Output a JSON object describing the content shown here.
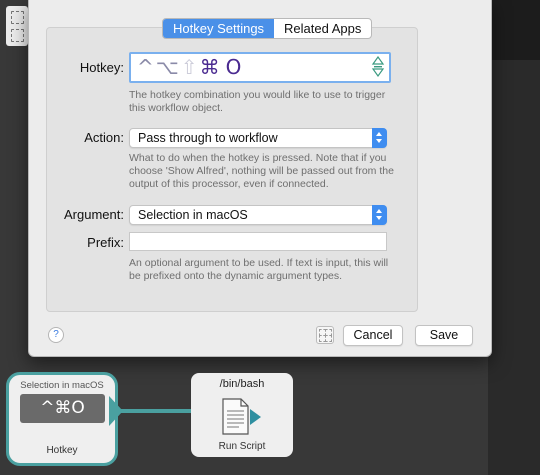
{
  "tabs": [
    {
      "label": "Hotkey Settings",
      "active": true
    },
    {
      "label": "Related Apps",
      "active": false
    }
  ],
  "hotkey": {
    "label": "Hotkey:",
    "mods_dim": "^⌥",
    "mod_ghost": "⇧",
    "mods_on": "⌘",
    "key": "O",
    "help": "The hotkey combination you would like to use to trigger this workflow object."
  },
  "action": {
    "label": "Action:",
    "value": "Pass through to workflow",
    "help": "What to do when the hotkey is pressed. Note that if you choose 'Show Alfred', nothing will be passed out from the output of this processor, even if connected."
  },
  "argument": {
    "label": "Argument:",
    "value": "Selection in macOS"
  },
  "prefix": {
    "label": "Prefix:",
    "value": "",
    "help": "An optional argument to be used. If text is input, this will be prefixed onto the dynamic argument types."
  },
  "footer": {
    "help_label": "?",
    "cancel_label": "Cancel",
    "save_label": "Save"
  },
  "nodes": {
    "hotkey": {
      "tag": "Selection in macOS",
      "combo": "^⌘O",
      "caption": "Hotkey"
    },
    "script": {
      "tag": "/bin/bash",
      "caption": "Run Script"
    }
  },
  "colors": {
    "accent": "#4a90e8",
    "connector": "#4aa0a0"
  }
}
